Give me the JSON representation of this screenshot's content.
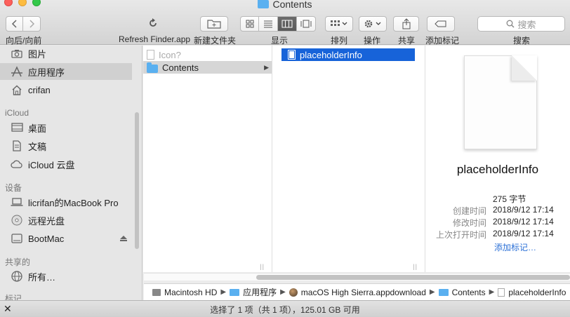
{
  "window": {
    "title": "Contents"
  },
  "toolbar": {
    "nav_label": "向后/向前",
    "refresh_label": "Refresh Finder.app",
    "new_folder_label": "新建文件夹",
    "view_label": "显示",
    "arrange_label": "排列",
    "action_label": "操作",
    "share_label": "共享",
    "tags_label": "添加标记",
    "search_label": "搜索",
    "search_placeholder": "搜索"
  },
  "sidebar": {
    "items_top": [
      {
        "label": "图片",
        "icon": "camera-icon"
      },
      {
        "label": "应用程序",
        "icon": "applications-icon"
      },
      {
        "label": "crifan",
        "icon": "home-icon"
      }
    ],
    "section_icloud": "iCloud",
    "items_icloud": [
      {
        "label": "桌面",
        "icon": "desktop-icon"
      },
      {
        "label": "文稿",
        "icon": "documents-icon"
      },
      {
        "label": "iCloud 云盘",
        "icon": "cloud-icon"
      }
    ],
    "section_devices": "设备",
    "items_devices": [
      {
        "label": "licrifan的MacBook Pro",
        "icon": "laptop-icon"
      },
      {
        "label": "远程光盘",
        "icon": "disc-icon"
      },
      {
        "label": "BootMac",
        "icon": "drive-icon"
      }
    ],
    "section_shared": "共享的",
    "items_shared": [
      {
        "label": "所有…",
        "icon": "network-icon"
      }
    ],
    "section_tags": "标记"
  },
  "columns": {
    "col1": [
      {
        "name": "Icon?"
      },
      {
        "name": "Contents"
      }
    ],
    "col2": [
      {
        "name": "placeholderInfo"
      }
    ]
  },
  "preview": {
    "name": "placeholderInfo",
    "size": "275 字节",
    "created_label": "创建时间",
    "created_value": "2018/9/12 17:14",
    "modified_label": "修改时间",
    "modified_value": "2018/9/12 17:14",
    "opened_label": "上次打开时间",
    "opened_value": "2018/9/12 17:14",
    "add_tags": "添加标记…"
  },
  "pathbar": [
    "Macintosh HD",
    "应用程序",
    "macOS High Sierra.appdownload",
    "Contents",
    "placeholderInfo"
  ],
  "status": {
    "text": "选择了 1 项（共 1 项），125.01 GB 可用"
  },
  "colors": {
    "selection_blue": "#1763d9",
    "folder_blue": "#5ab0f0",
    "link_blue": "#2a6fd6"
  }
}
